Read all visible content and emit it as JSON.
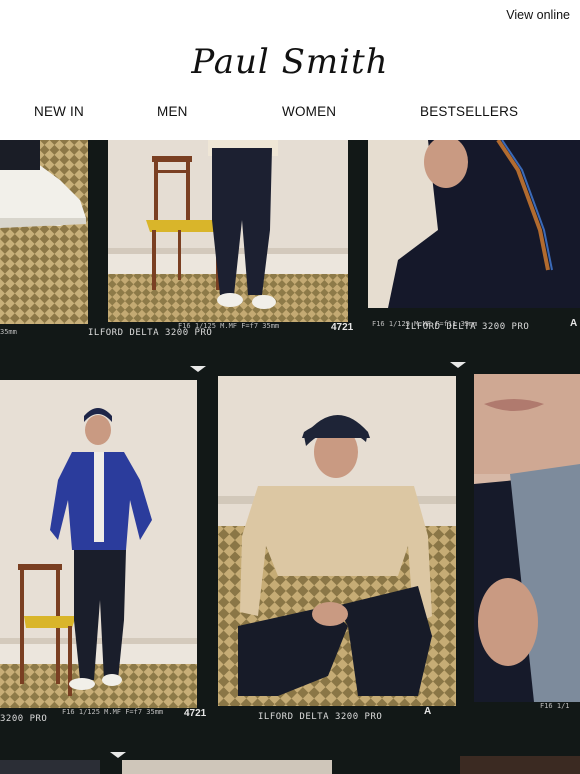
{
  "header": {
    "view_online": "View online",
    "logo": "Paul Smith"
  },
  "nav": {
    "items": [
      {
        "label": "NEW IN"
      },
      {
        "label": "MEN"
      },
      {
        "label": "WOMEN"
      },
      {
        "label": "BESTSELLERS"
      }
    ]
  },
  "hero": {
    "strip1": {
      "film_label_1": "ILFORD DELTA 3200 PRO",
      "film_label_2": "ILFORD DELTA 3200 PRO",
      "frame_number": "4721",
      "frame_marker": "A",
      "exposure_1": "F16 1/125 M.MF F=f7 35mm",
      "exposure_2": "F16 1/125 M.MF F=f11 35mm",
      "edge_code": "35mm"
    },
    "strip2": {
      "film_label_1": "3200 PRO",
      "film_label_2": "ILFORD DELTA 3200 PRO",
      "frame_number": "4721",
      "frame_marker": "A",
      "exposure_1": "F16 1/125 M.MF F=f7 35mm",
      "exposure_2": "F16 1/1"
    }
  },
  "colors": {
    "film_black": "#121817",
    "wall_cream": "#e8dfd4",
    "floor_check": "#a8925a",
    "jacket_blue": "#2b3c9c",
    "sweater_beige": "#dcc7a3",
    "chair_wood": "#7a3f22",
    "chair_seat": "#d9b52a"
  }
}
